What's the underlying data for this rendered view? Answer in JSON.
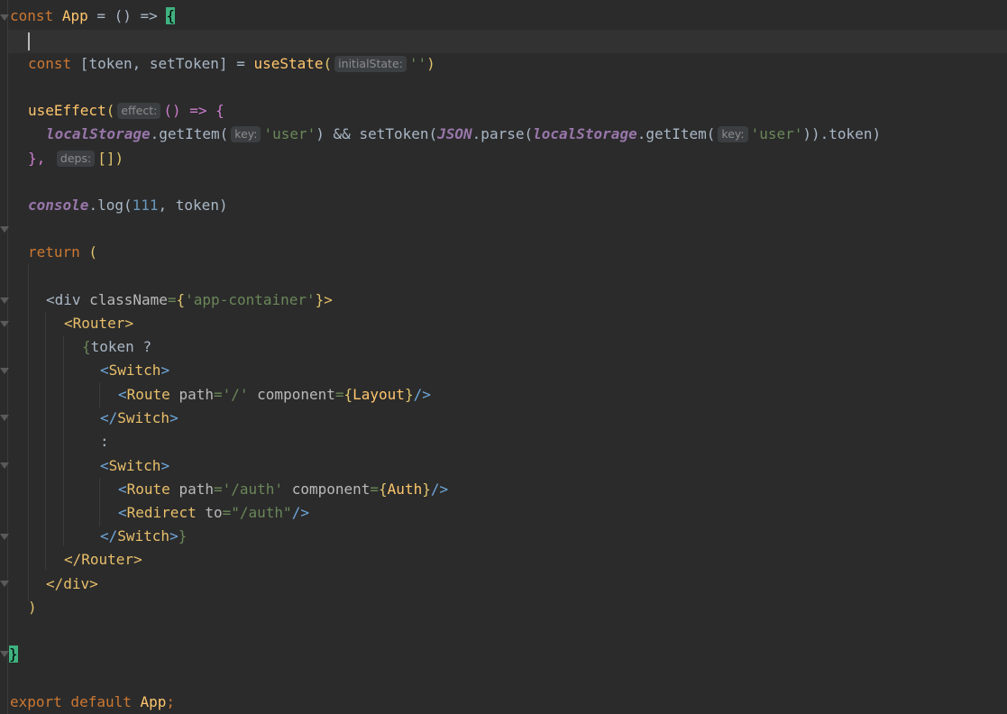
{
  "editor": {
    "colors": {
      "background": "#2b2b2b",
      "keyword": "#cc7832",
      "function": "#ffc66d",
      "string": "#6a8759",
      "number": "#6897bb",
      "global": "#9876aa",
      "tag": "#e8bf6a",
      "brace_highlight": "#3fb27f"
    },
    "lines": {
      "l1": {
        "kw": "const",
        "name": "App",
        "eq": " = () => ",
        "brace": "{"
      },
      "l3": {
        "kw": "const",
        "decl": " [token, setToken] = ",
        "fn": "useState",
        "open": "(",
        "hint": "initialState:",
        "str": "''",
        "close": ")"
      },
      "l5": {
        "fn": "useEffect",
        "open": "(",
        "hint": "effect:",
        "rest": "() => {"
      },
      "l6": {
        "glob1": "localStorage",
        "m1": ".getItem(",
        "hint1": "key:",
        "str1": "'user'",
        "mid": ") && setToken(",
        "glob2": "JSON",
        "m2": ".parse(",
        "glob3": "localStorage",
        "m3": ".getItem(",
        "hint2": "key:",
        "str2": "'user'",
        "end": ")).token)"
      },
      "l7": {
        "close": "},",
        "hint": "deps:",
        "arr": "[])"
      },
      "l9": {
        "glob": "console",
        "m": ".log(",
        "num": "111",
        "rest": ", token)"
      },
      "l11": {
        "kw": "return",
        "rest": " ("
      },
      "l13": {
        "lt": "<",
        "tag": "div",
        "attr": " className",
        "eq": "=",
        "ob": "{",
        "str": "'app-container'",
        "cb": "}",
        "gt": ">"
      },
      "l14": {
        "lt": "<",
        "tag": "Router",
        "gt": ">"
      },
      "l15": {
        "ob": "{",
        "rest": "token ?"
      },
      "l16": {
        "lt": "<",
        "tag": "Switch",
        "gt": ">"
      },
      "l17": {
        "lt": "<",
        "tag": "Route",
        "attr1": " path",
        "eq1": "=",
        "str1": "'/'",
        "attr2": " component",
        "eq2": "=",
        "ob": "{",
        "val": "Layout",
        "cb": "}",
        "end": "/>"
      },
      "l18": {
        "lt": "</",
        "tag": "Switch",
        "gt": ">"
      },
      "l19": {
        "colon": ":"
      },
      "l20": {
        "lt": "<",
        "tag": "Switch",
        "gt": ">"
      },
      "l21": {
        "lt": "<",
        "tag": "Route",
        "attr1": " path",
        "eq1": "=",
        "str1": "'/auth'",
        "attr2": " component",
        "eq2": "=",
        "ob": "{",
        "val": "Auth",
        "cb": "}",
        "end": "/>"
      },
      "l22": {
        "lt": "<",
        "tag": "Redirect",
        "attr": " to",
        "eq": "=",
        "str": "\"/auth\"",
        "end": "/>"
      },
      "l23": {
        "lt": "</",
        "tag": "Switch",
        "gt": ">",
        "cb": "}"
      },
      "l24": {
        "lt": "</",
        "tag": "Router",
        "gt": ">"
      },
      "l25": {
        "lt": "</",
        "tag": "div",
        "gt": ">"
      },
      "l26": {
        "close": ")"
      },
      "l28": {
        "brace": "}"
      },
      "l30": {
        "kw": "export default",
        "name": "App",
        "semi": ";"
      }
    }
  }
}
